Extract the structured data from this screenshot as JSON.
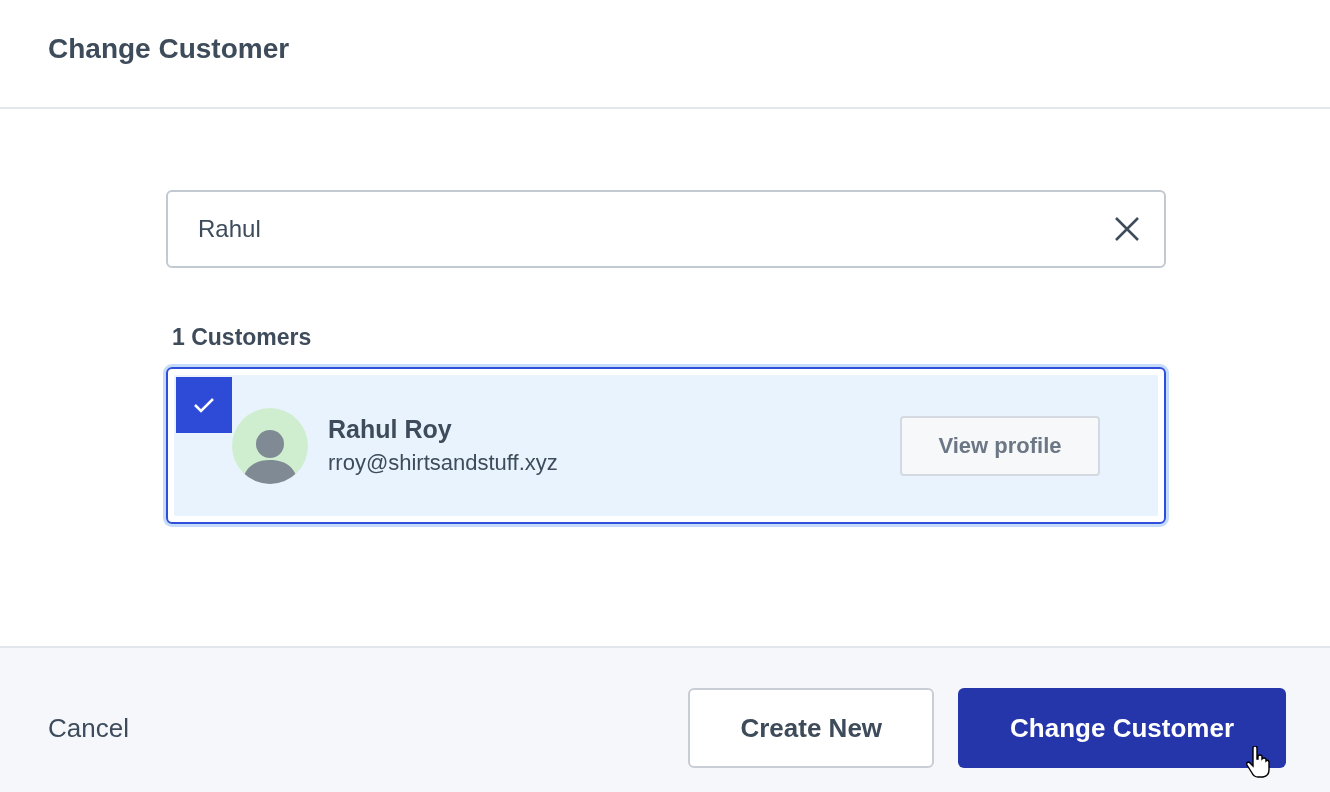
{
  "dialog": {
    "title": "Change Customer"
  },
  "search": {
    "value": "Rahul"
  },
  "results": {
    "count_label": "1 Customers",
    "customers": [
      {
        "name": "Rahul Roy",
        "email": "rroy@shirtsandstuff.xyz",
        "selected": true,
        "action": "View profile"
      }
    ]
  },
  "footer": {
    "cancel": "Cancel",
    "buttons": [
      {
        "label": "Create New",
        "kind": "secondary"
      },
      {
        "label": "Change Customer",
        "kind": "primary"
      }
    ]
  }
}
